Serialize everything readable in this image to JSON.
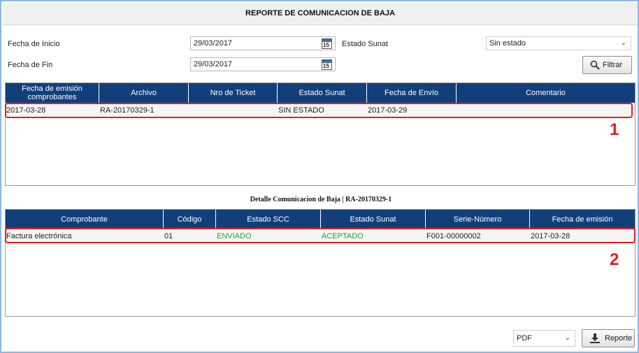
{
  "title": "REPORTE DE COMUNICACION DE BAJA",
  "filters": {
    "fecha_inicio_label": "Fecha de Inicio",
    "fecha_inicio_value": "29/03/2017",
    "fecha_fin_label": "Fecha de Fin",
    "fecha_fin_value": "29/03/2017",
    "estado_label": "Estado Sunat",
    "estado_value": "Sin estado",
    "calendar_day": "15",
    "filtrar_label": "Filtrar"
  },
  "main_grid": {
    "headers": [
      "Fecha de emisión comprobantes",
      "Archivo",
      "Nro de Ticket",
      "Estado Sunat",
      "Fecha de Envío",
      "Comentario"
    ],
    "rows": [
      [
        "2017-03-28",
        "RA-20170329-1",
        "",
        "SIN ESTADO",
        "2017-03-29",
        ""
      ]
    ]
  },
  "detail_title": "Detalle Comunicacion de Baja | RA-20170329-1",
  "detail_grid": {
    "headers": [
      "Comprobante",
      "Código",
      "Estado SCC",
      "Estado Sunat",
      "Serie-Número",
      "Fecha de emisión"
    ],
    "rows": [
      [
        "Factura electrónica",
        "01",
        "ENVIADO",
        "ACEPTADO",
        "F001-00000002",
        "2017-03-28"
      ]
    ]
  },
  "markers": [
    "1",
    "2"
  ],
  "footer": {
    "format_value": "PDF",
    "reporte_label": "Reporte"
  },
  "colors": {
    "header_bg": "#123f7a",
    "highlight": "#e02020",
    "status_green": "#2e9a2e"
  }
}
